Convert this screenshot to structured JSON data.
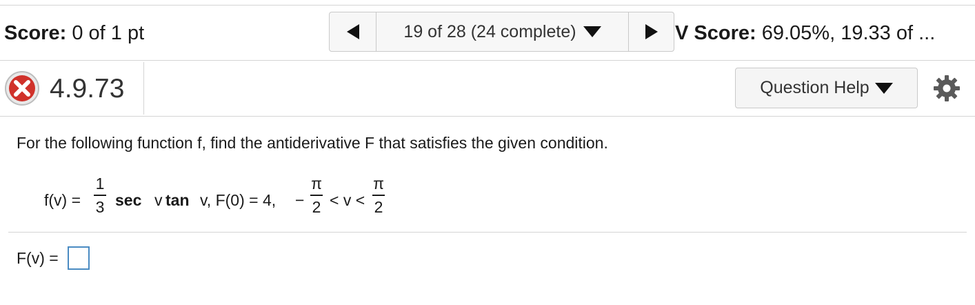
{
  "header": {
    "score_label": "Score:",
    "score_value": "0 of 1 pt",
    "hw_score_label": "V Score:",
    "hw_score_value": "69.05%, 19.33 of ..."
  },
  "navigation": {
    "progress": "19 of 28 (24 complete)",
    "prev_icon": "triangle-left-icon",
    "next_icon": "triangle-right-icon",
    "dropdown_icon": "triangle-down-icon"
  },
  "question": {
    "status": "incorrect",
    "status_icon": "red-x-icon",
    "status_color": "#d0322b",
    "number": "4.9.73",
    "help_button": "Question Help",
    "settings_icon": "gear-icon",
    "prompt": "For the following function f, find the antiderivative F that satisfies the given condition.",
    "formula": {
      "lhs": "f(v) =",
      "coef_num": "1",
      "coef_den": "3",
      "sec": "sec",
      "var1": "v",
      "tan": "tan",
      "var2": "v, F(0) = 4,",
      "minus": "−",
      "pi1": "π",
      "two1": "2",
      "ineq": "< v <",
      "pi2": "π",
      "two2": "2"
    },
    "answer_label": "F(v) =",
    "answer_value": ""
  },
  "colors": {
    "input_border": "#4a8bc2",
    "divider": "#d4d4d4",
    "button_bg": "#f5f5f5"
  }
}
